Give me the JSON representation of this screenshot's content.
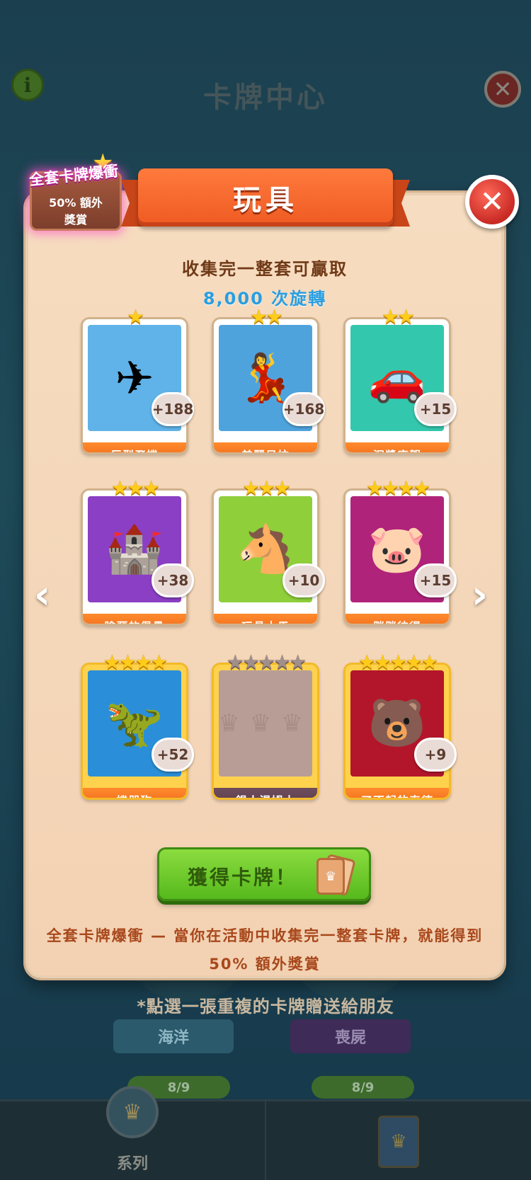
{
  "background": {
    "title": "卡牌中心",
    "info_icon": "i",
    "note": "*點選一張重複的卡牌贈送給朋友",
    "sets": [
      {
        "name": "海洋",
        "progress": "8/9"
      },
      {
        "name": "喪屍",
        "progress": "8/9"
      }
    ],
    "tabs": [
      {
        "label": "系列"
      },
      {
        "label": ""
      }
    ]
  },
  "badge": {
    "title": "全套卡牌爆衝",
    "line1": "50% 額外",
    "line2": "獎賞"
  },
  "modal": {
    "title": "玩具",
    "collect_text": "收集完一整套可贏取",
    "reward_text": "8,000 次旋轉",
    "button_label": "獲得卡牌！",
    "footer_line1": "全套卡牌爆衝 — 當你在活動中收集完一整套卡牌，就能得到",
    "footer_line2": "50% 額外獎賞"
  },
  "cards": [
    {
      "name": "巨型飛機",
      "stars": 1,
      "count": "+188",
      "owned": true,
      "art": "✈",
      "bg": "#5fb3e8",
      "frame": "white"
    },
    {
      "name": "美麗貝拉",
      "stars": 2,
      "count": "+168",
      "owned": true,
      "art": "💃",
      "bg": "#4fa3dd",
      "frame": "white"
    },
    {
      "name": "泥漿座駕",
      "stars": 2,
      "count": "+15",
      "owned": true,
      "art": "🚗",
      "bg": "#33c7ad",
      "frame": "white"
    },
    {
      "name": "險惡的堡壘",
      "stars": 3,
      "count": "+38",
      "owned": true,
      "art": "🏰",
      "bg": "#8b3fc4",
      "frame": "white"
    },
    {
      "name": "玩具木馬",
      "stars": 3,
      "count": "+10",
      "owned": true,
      "art": "🐴",
      "bg": "#8fcf3a",
      "frame": "white"
    },
    {
      "name": "胖胖彼得",
      "stars": 4,
      "count": "+15",
      "owned": true,
      "art": "🐷",
      "bg": "#b0237a",
      "frame": "white"
    },
    {
      "name": "機器狗",
      "stars": 4,
      "count": "+52",
      "owned": true,
      "art": "🦖",
      "bg": "#2a8fd8",
      "frame": "gold"
    },
    {
      "name": "錫人湯姆士",
      "stars": 5,
      "count": "",
      "owned": false,
      "art": "♛",
      "bg": "#b89d97",
      "frame": "dark"
    },
    {
      "name": "了不起的泰德",
      "stars": 5,
      "count": "+9",
      "owned": true,
      "art": "🐻",
      "bg": "#b3162a",
      "frame": "gold"
    }
  ]
}
